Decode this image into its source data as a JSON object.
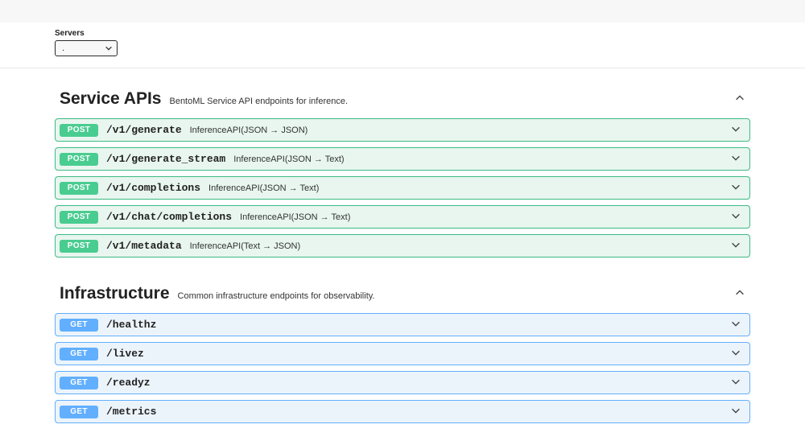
{
  "servers": {
    "label": "Servers",
    "selected": "."
  },
  "sections": [
    {
      "title": "Service APIs",
      "description": "BentoML Service API endpoints for inference.",
      "method_class": "post",
      "endpoints": [
        {
          "method": "POST",
          "path": "/v1/generate",
          "desc": "InferenceAPI(JSON → JSON)"
        },
        {
          "method": "POST",
          "path": "/v1/generate_stream",
          "desc": "InferenceAPI(JSON → Text)"
        },
        {
          "method": "POST",
          "path": "/v1/completions",
          "desc": "InferenceAPI(JSON → Text)"
        },
        {
          "method": "POST",
          "path": "/v1/chat/completions",
          "desc": "InferenceAPI(JSON → Text)"
        },
        {
          "method": "POST",
          "path": "/v1/metadata",
          "desc": "InferenceAPI(Text → JSON)"
        }
      ]
    },
    {
      "title": "Infrastructure",
      "description": "Common infrastructure endpoints for observability.",
      "method_class": "get",
      "endpoints": [
        {
          "method": "GET",
          "path": "/healthz",
          "desc": ""
        },
        {
          "method": "GET",
          "path": "/livez",
          "desc": ""
        },
        {
          "method": "GET",
          "path": "/readyz",
          "desc": ""
        },
        {
          "method": "GET",
          "path": "/metrics",
          "desc": ""
        }
      ]
    }
  ]
}
